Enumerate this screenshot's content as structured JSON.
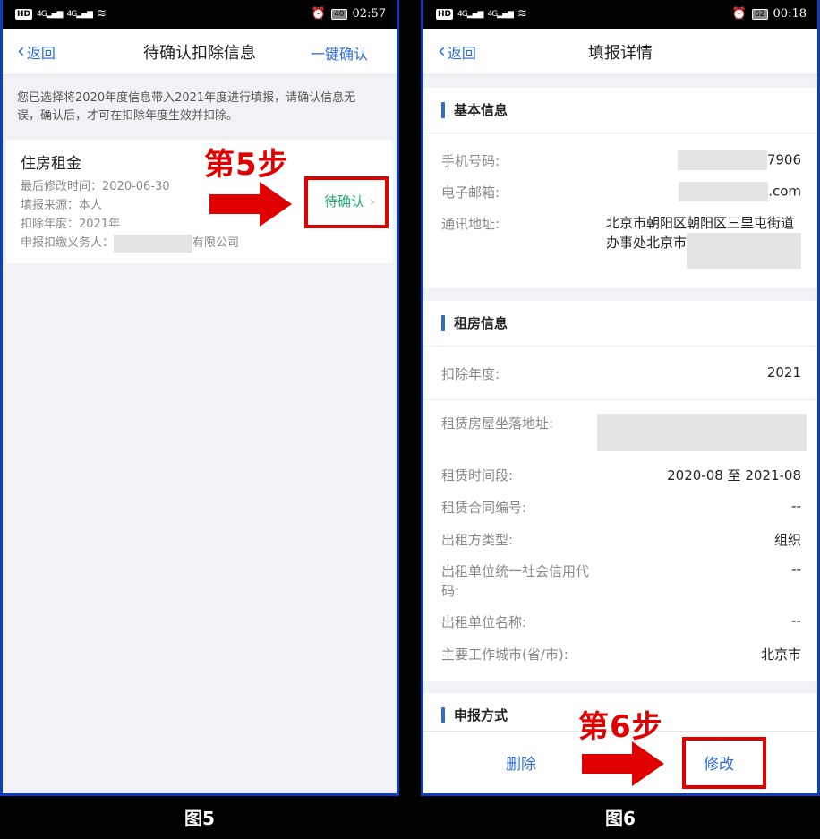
{
  "figure5": {
    "status": {
      "hd": "HD",
      "net1": "4G",
      "net2": "4G",
      "battery": "40",
      "time": "02:57"
    },
    "nav": {
      "back": "返回",
      "title": "待确认扣除信息",
      "action": "一键确认"
    },
    "notice": "您已选择将2020年度信息带入2021年度进行填报，请确认信息无误，确认后，才可在扣除年度生效并扣除。",
    "item": {
      "name": "住房租金",
      "modified": "最后修改时间：2020-06-30",
      "source": "填报来源：本人",
      "year": "扣除年度：2021年",
      "agent_prefix": "申报扣缴义务人：",
      "agent_suffix": "有限公司",
      "status": "待确认"
    },
    "step": "第5步",
    "caption": "图5"
  },
  "figure6": {
    "status": {
      "hd": "HD",
      "net1": "4G",
      "net2": "4G",
      "battery": "62",
      "time": "00:18"
    },
    "nav": {
      "back": "返回",
      "title": "填报详情"
    },
    "basic": {
      "heading": "基本信息",
      "phone_label": "手机号码:",
      "phone_value": "7906",
      "email_label": "电子邮箱:",
      "email_value": ".com",
      "address_label": "通讯地址:",
      "address_line1": "北京市朝阳区朝阳区三里屯街道",
      "address_line2": "办事处北京市"
    },
    "rent": {
      "heading": "租房信息",
      "year_label": "扣除年度:",
      "year_value": "2021",
      "location_label": "租赁房屋坐落地址:",
      "period_label": "租赁时间段:",
      "period_value": "2020-08 至 2021-08",
      "contract_label": "租赁合同编号:",
      "contract_value": "--",
      "lessor_type_label": "出租方类型:",
      "lessor_type_value": "组织",
      "credit_label_1": "出租单位统一社会信用代",
      "credit_label_2": "码:",
      "credit_value": "--",
      "lessor_name_label": "出租单位名称:",
      "lessor_name_value": "--",
      "city_label": "主要工作城市(省/市):",
      "city_value": "北京市"
    },
    "declare": {
      "heading": "申报方式"
    },
    "actions": {
      "delete": "删除",
      "modify": "修改"
    },
    "step": "第6步",
    "caption": "图6"
  },
  "colors": {
    "accent": "#2e6bd6",
    "pending": "#1fa876",
    "annotation": "#e00000",
    "frame": "#0b3fc0"
  }
}
